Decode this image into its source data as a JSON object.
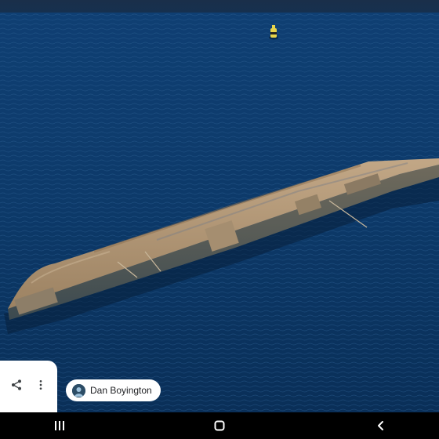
{
  "photo": {
    "subject": "capsized-ship-wreck"
  },
  "actions": {
    "share_icon": "share-icon",
    "more_icon": "more-vert-icon"
  },
  "author": {
    "name": "Dan Boyington"
  },
  "navigation": {
    "recents_icon": "recents-icon",
    "home_icon": "home-icon",
    "back_icon": "back-icon"
  },
  "colors": {
    "water": "#0d3a6a",
    "hull": "#b39a7a",
    "buoy": "#e8d44a",
    "card": "#ffffff",
    "nav_bar": "#000000"
  }
}
